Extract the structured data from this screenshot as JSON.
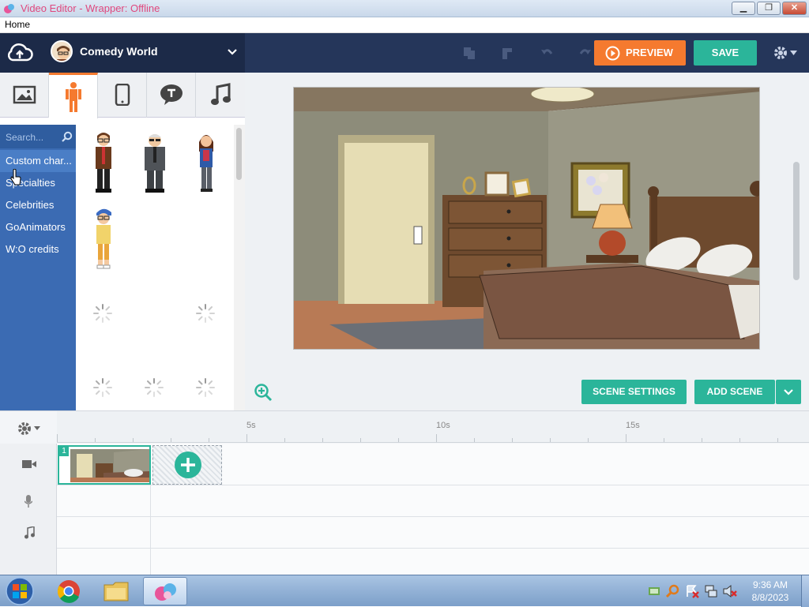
{
  "window": {
    "title": "Video Editor - Wrapper: Offline",
    "min_label": "▁",
    "max_label": "❐",
    "close_label": "✕"
  },
  "menu": {
    "home": "Home"
  },
  "topbar": {
    "project_name": "Comedy World",
    "preview_label": "PREVIEW",
    "save_label": "SAVE"
  },
  "asset_tabs": [
    {
      "name": "image-icon"
    },
    {
      "name": "character-icon"
    },
    {
      "name": "prop-device-icon"
    },
    {
      "name": "text-bubble-icon"
    },
    {
      "name": "music-note-icon"
    }
  ],
  "categories": {
    "search_placeholder": "Search...",
    "items": [
      {
        "label": "Custom char..."
      },
      {
        "label": "Specialties"
      },
      {
        "label": "Celebrities"
      },
      {
        "label": "GoAnimators"
      },
      {
        "label": "W:O credits"
      }
    ]
  },
  "stage": {
    "scene_settings_label": "SCENE SETTINGS",
    "add_scene_label": "ADD SCENE"
  },
  "timeline": {
    "ticks": [
      "5s",
      "10s",
      "15s"
    ],
    "scene_number": "1"
  },
  "taskbar": {
    "time": "9:36 AM",
    "date": "8/8/2023"
  },
  "colors": {
    "accent_orange": "#f57a2f",
    "accent_green": "#2bb59a",
    "header_navy": "#25365a",
    "category_blue": "#3b6bb3"
  }
}
